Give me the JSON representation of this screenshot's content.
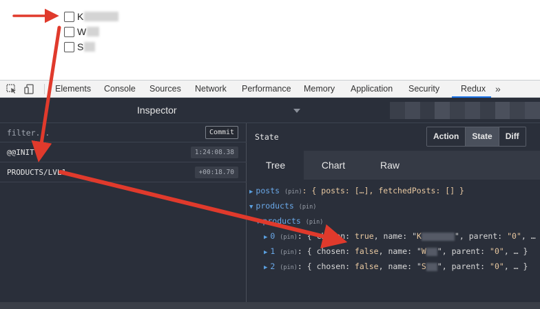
{
  "page": {
    "checkboxes": [
      {
        "label": "K"
      },
      {
        "label": "W"
      },
      {
        "label": "S"
      }
    ]
  },
  "devtools": {
    "tabs": [
      {
        "label": "Elements"
      },
      {
        "label": "Console"
      },
      {
        "label": "Sources"
      },
      {
        "label": "Network"
      },
      {
        "label": "Performance"
      },
      {
        "label": "Memory"
      },
      {
        "label": "Application"
      },
      {
        "label": "Security"
      },
      {
        "label": "Redux"
      }
    ],
    "active_tab": "Redux",
    "more_label": "»",
    "accent_color": "#1a73e8"
  },
  "redux": {
    "title": "Inspector",
    "filter_placeholder": "filter...",
    "commit_label": "Commit",
    "actions": [
      {
        "name": "@@INIT",
        "time": "1:24:08.38"
      },
      {
        "name": "PRODUCTS/LVL1",
        "time": "+00:18.70"
      }
    ],
    "state_label": "State",
    "segments": [
      {
        "label": "Action"
      },
      {
        "label": "State"
      },
      {
        "label": "Diff"
      }
    ],
    "active_segment": "State",
    "view_tabs": [
      {
        "label": "Tree"
      },
      {
        "label": "Chart"
      },
      {
        "label": "Raw"
      }
    ],
    "active_view": "Tree",
    "tree": {
      "pin": "(pin)",
      "posts_key": "posts",
      "posts_value": ": { posts: […], fetchedPosts: [] }",
      "products_key": "products",
      "products_inner_key": "products",
      "items": [
        {
          "index": "0",
          "chosen": "true",
          "name_prefix": "K",
          "parent": "\"0\""
        },
        {
          "index": "1",
          "chosen": "false",
          "name_prefix": "W",
          "parent": "\"0\""
        },
        {
          "index": "2",
          "chosen": "false",
          "name_prefix": "S",
          "parent": "\"0\""
        }
      ]
    }
  },
  "colors": {
    "annotation_arrow": "#e03a2c",
    "panel_bg": "#2a2f3a",
    "tree_key": "#6aa8e8"
  }
}
